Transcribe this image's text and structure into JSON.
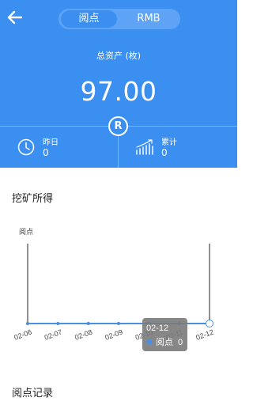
{
  "header": {
    "tabs": [
      {
        "label": "阅点",
        "active": true
      },
      {
        "label": "RMB",
        "active": false
      }
    ],
    "asset_label": "总资产 (枚)",
    "asset_value": "97.00",
    "badge": "R",
    "stats": {
      "yesterday": {
        "label": "昨日",
        "value": "0",
        "icon": "clock-icon"
      },
      "total": {
        "label": "累计",
        "value": "0",
        "icon": "bar-chart-icon"
      }
    }
  },
  "mining": {
    "title": "挖矿所得",
    "chart_data": {
      "type": "line",
      "ylabel": "阅点",
      "categories": [
        "02-06",
        "02-07",
        "02-08",
        "02-09",
        "02-10",
        "02-11",
        "02-12"
      ],
      "series": [
        {
          "name": "阅点",
          "values": [
            0,
            0,
            0,
            0,
            0,
            0,
            0
          ]
        }
      ],
      "tooltip": {
        "title": "02-12",
        "series_label": "阅点",
        "value": "0"
      }
    }
  },
  "records": {
    "title": "阅点记录"
  },
  "colors": {
    "primary": "#3b8ff0",
    "segment_bg": "#5ea3f5",
    "line": "#4a90e2",
    "tooltip_bg": "#7a7a7a"
  }
}
